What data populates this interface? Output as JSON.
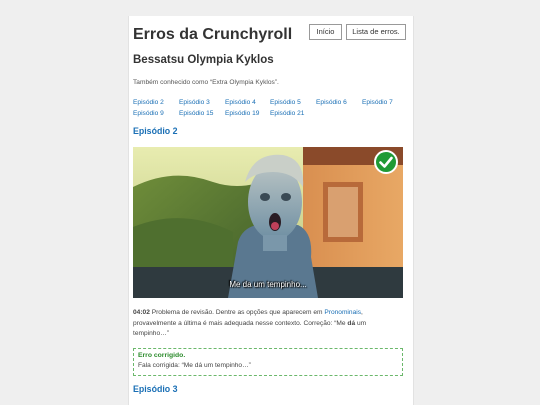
{
  "header": {
    "site_title": "Erros da Crunchyroll",
    "nav": {
      "home": "Início",
      "errors_list": "Lista de erros."
    }
  },
  "anime": {
    "title": "Bessatsu Olympia Kyklos",
    "aka": "Também conhecido como “Extra Olympia Kyklos”."
  },
  "episode_links": [
    "Episódio 2",
    "Episódio 3",
    "Episódio 4",
    "Episódio 5",
    "Episódio 6",
    "Episódio 7",
    "Episódio 9",
    "Episódio 15",
    "Episódio 19",
    "Episódio 21"
  ],
  "sections": {
    "current": "Episódio 2",
    "next": "Episódio 3"
  },
  "screenshot": {
    "subtitle": "Me da um tempinho...",
    "status_icon": "check-circle-icon",
    "status_color": "#1f9a35"
  },
  "error": {
    "timestamp": "04:02",
    "text_before": " Problema de revisão. Dentre as opções que aparecem em ",
    "link": "Pronominais",
    "text_mid": ", provavelmente a última é mais adequada nesse contexto. Correção: “Me ",
    "bold_word": "dá",
    "text_end": " um tempinho…”"
  },
  "fixed": {
    "title": "Erro corrigido.",
    "line": "Fala corrigida: “Me dá um tempinho…”"
  },
  "colors": {
    "link": "#1a6fb5",
    "fixed_green": "#2a8a2a",
    "fixed_border": "#6bb86b"
  }
}
